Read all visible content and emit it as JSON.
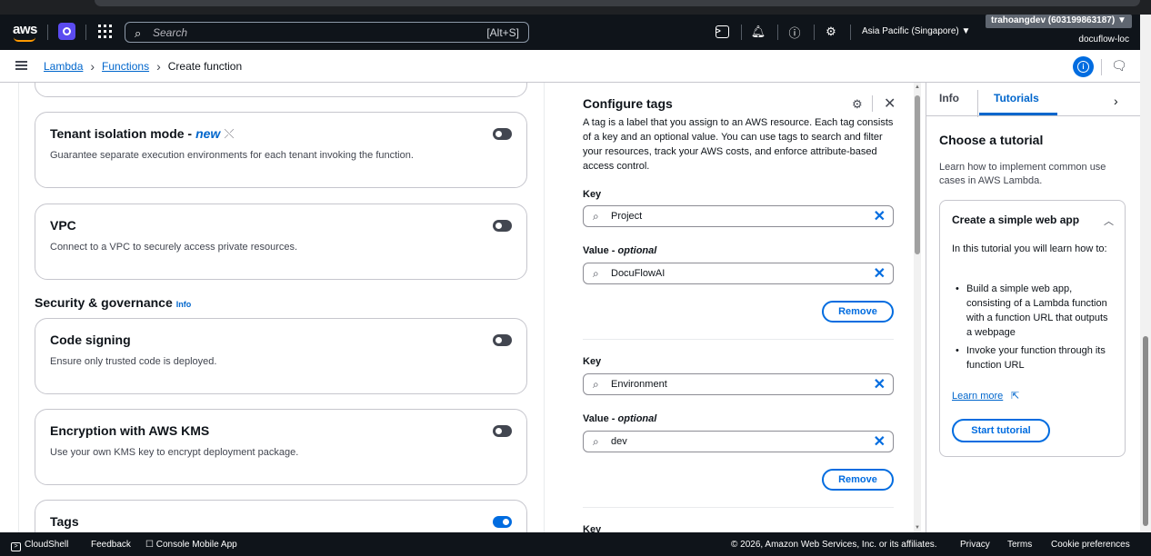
{
  "header": {
    "search_placeholder": "Search",
    "search_shortcut": "[Alt+S]",
    "region": "Asia Pacific (Singapore) ▼",
    "account": "trahoangdev (603199863187) ▼",
    "account_sub": "docuflow-loc"
  },
  "breadcrumb": {
    "items": [
      "Lambda",
      "Functions"
    ],
    "current": "Create function"
  },
  "main": {
    "tenant": {
      "title": "Tenant isolation mode -",
      "new": "new",
      "desc": "Guarantee separate execution environments for each tenant invoking the function."
    },
    "vpc": {
      "title": "VPC",
      "desc": "Connect to a VPC to securely access private resources."
    },
    "security_heading": "Security & governance",
    "security_info": "Info",
    "code_signing": {
      "title": "Code signing",
      "desc": "Ensure only trusted code is deployed."
    },
    "encryption": {
      "title": "Encryption with AWS KMS",
      "desc": "Use your own KMS key to encrypt deployment package."
    },
    "tags": {
      "title": "Tags"
    }
  },
  "tags_panel": {
    "title": "Configure tags",
    "description": "A tag is a label that you assign to an AWS resource. Each tag consists of a key and an optional value. You can use tags to search and filter your resources, track your AWS costs, and enforce attribute-based access control.",
    "key_label": "Key",
    "value_label": "Value - ",
    "value_optional": "optional",
    "remove_label": "Remove",
    "tags": [
      {
        "key": "Project",
        "value": "DocuFlowAI"
      },
      {
        "key": "Environment",
        "value": "dev"
      }
    ],
    "next_key_label": "Key"
  },
  "help_panel": {
    "tab_info": "Info",
    "tab_tutorials": "Tutorials",
    "heading": "Choose a tutorial",
    "intro": "Learn how to implement common use cases in AWS Lambda.",
    "tutorial": {
      "title": "Create a simple web app",
      "lead": "In this tutorial you will learn how to:",
      "steps": [
        "Build a simple web app, consisting of a Lambda function with a function URL that outputs a webpage",
        "Invoke your function through its function URL"
      ],
      "learn_more": "Learn more",
      "start": "Start tutorial"
    }
  },
  "footer": {
    "cloudshell": "CloudShell",
    "feedback": "Feedback",
    "mobile": "Console Mobile App",
    "copyright": "© 2026, Amazon Web Services, Inc. or its affiliates.",
    "privacy": "Privacy",
    "terms": "Terms",
    "cookies": "Cookie preferences"
  },
  "colors": {
    "accent": "#006ce0",
    "header_bg": "#0f141a",
    "brand_orange": "#ff9900"
  }
}
